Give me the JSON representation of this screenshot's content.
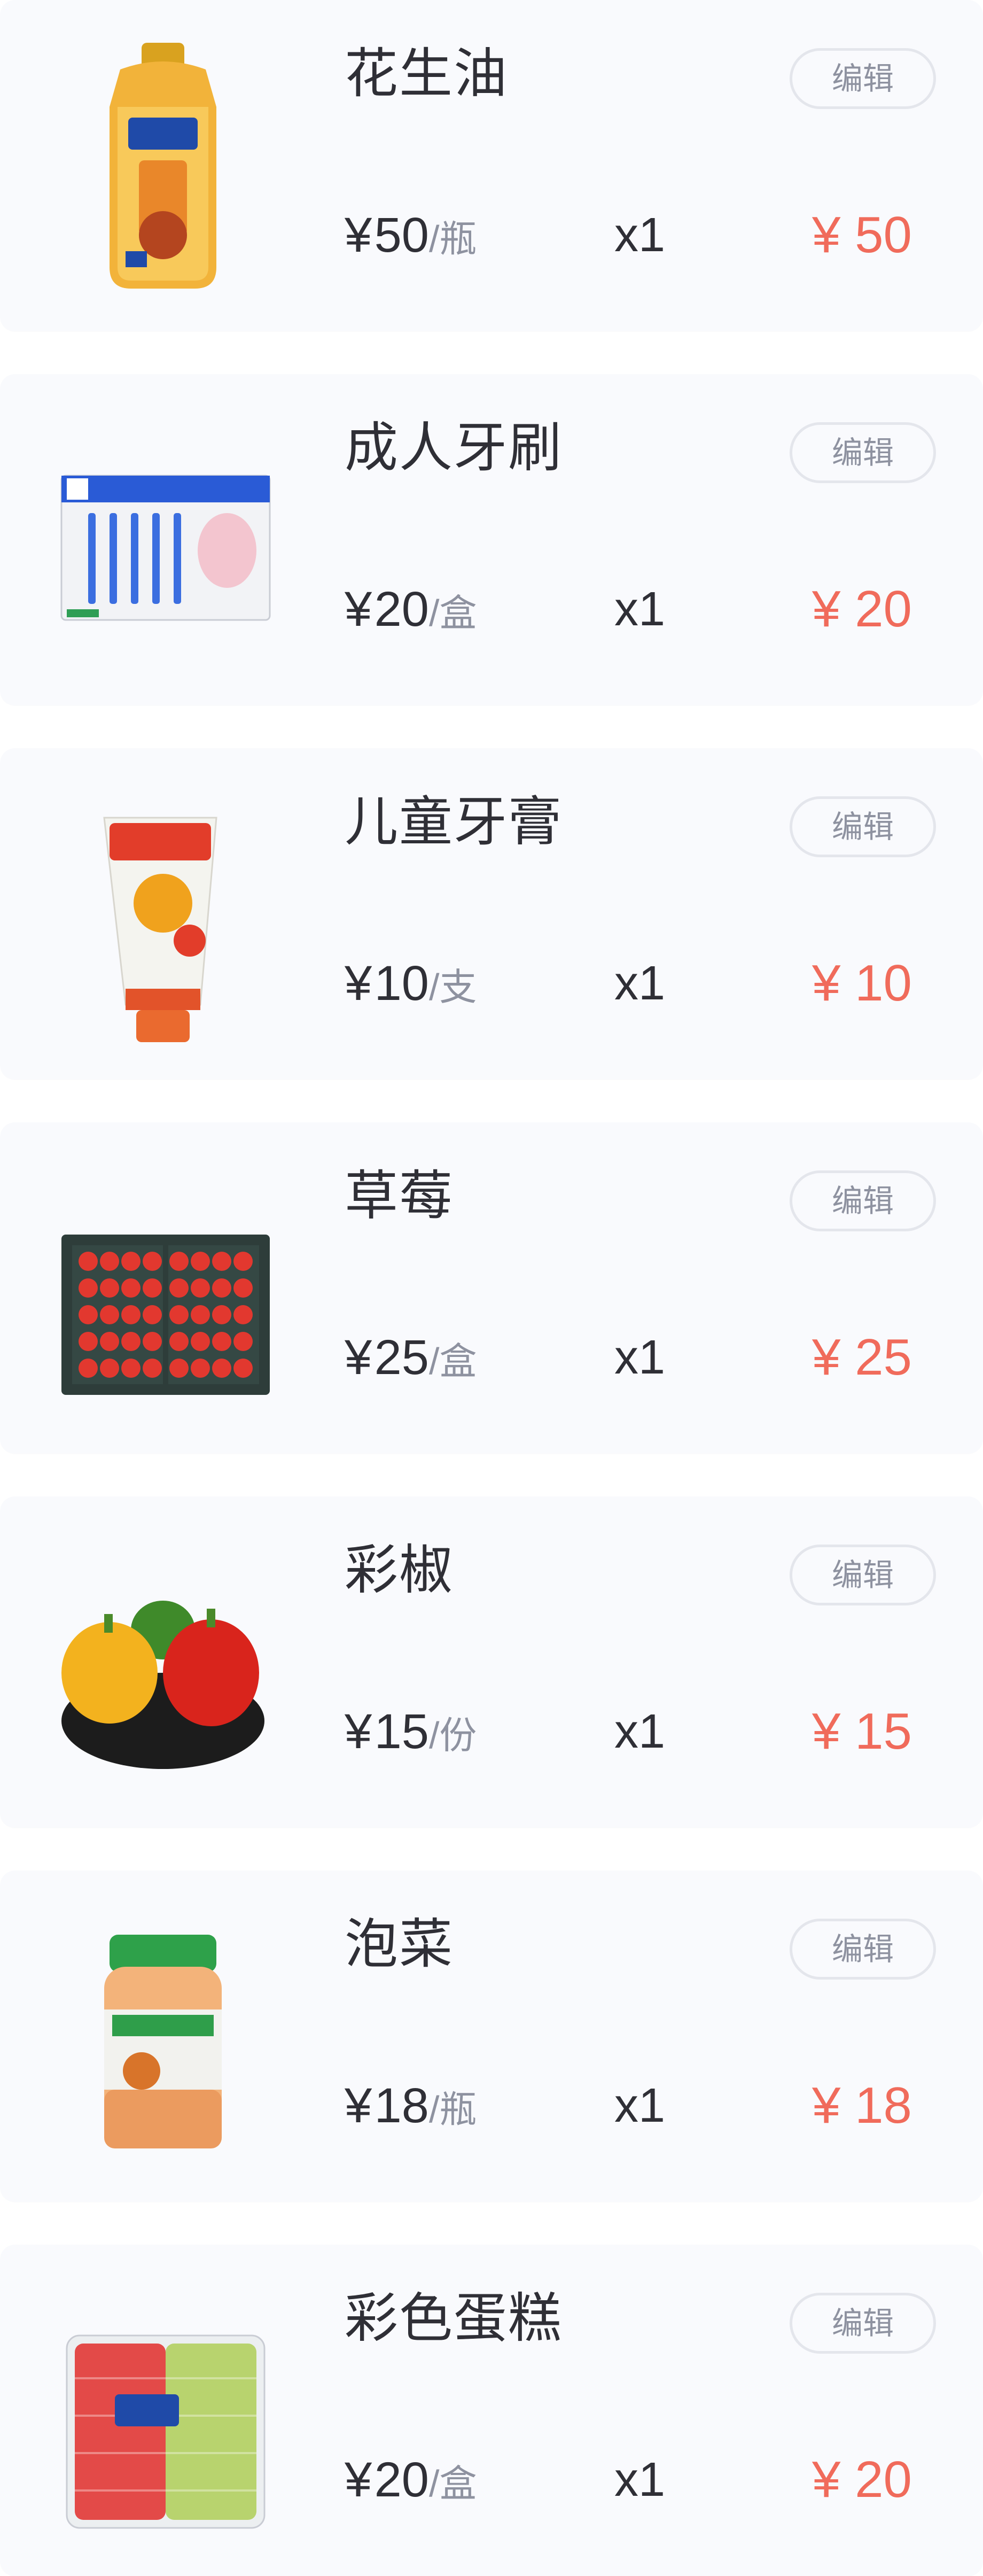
{
  "items": [
    {
      "name": "花生油",
      "edit_label": "编辑",
      "currency": "¥",
      "unit_price": "50",
      "unit": "/瓶",
      "qty": "x1",
      "total": "¥ 50",
      "image": "peanut-oil-image"
    },
    {
      "name": "成人牙刷",
      "edit_label": "编辑",
      "currency": "¥",
      "unit_price": "20",
      "unit": "/盒",
      "qty": "x1",
      "total": "¥ 20",
      "image": "toothbrush-pack-image"
    },
    {
      "name": "儿童牙膏",
      "edit_label": "编辑",
      "currency": "¥",
      "unit_price": "10",
      "unit": "/支",
      "qty": "x1",
      "total": "¥ 10",
      "image": "kids-toothpaste-image"
    },
    {
      "name": "草莓",
      "edit_label": "编辑",
      "currency": "¥",
      "unit_price": "25",
      "unit": "/盒",
      "qty": "x1",
      "total": "¥ 25",
      "image": "strawberry-box-image"
    },
    {
      "name": "彩椒",
      "edit_label": "编辑",
      "currency": "¥",
      "unit_price": "15",
      "unit": "/份",
      "qty": "x1",
      "total": "¥ 15",
      "image": "bell-peppers-image"
    },
    {
      "name": "泡菜",
      "edit_label": "编辑",
      "currency": "¥",
      "unit_price": "18",
      "unit": "/瓶",
      "qty": "x1",
      "total": "¥ 18",
      "image": "kimchi-jar-image"
    },
    {
      "name": "彩色蛋糕",
      "edit_label": "编辑",
      "currency": "¥",
      "unit_price": "20",
      "unit": "/盒",
      "qty": "x1",
      "total": "¥ 20",
      "image": "colored-cake-image"
    }
  ],
  "colors": {
    "card_bg": "#f9fafd",
    "text": "#2f2f36",
    "muted": "#8e92a0",
    "accent": "#f06b5b"
  }
}
